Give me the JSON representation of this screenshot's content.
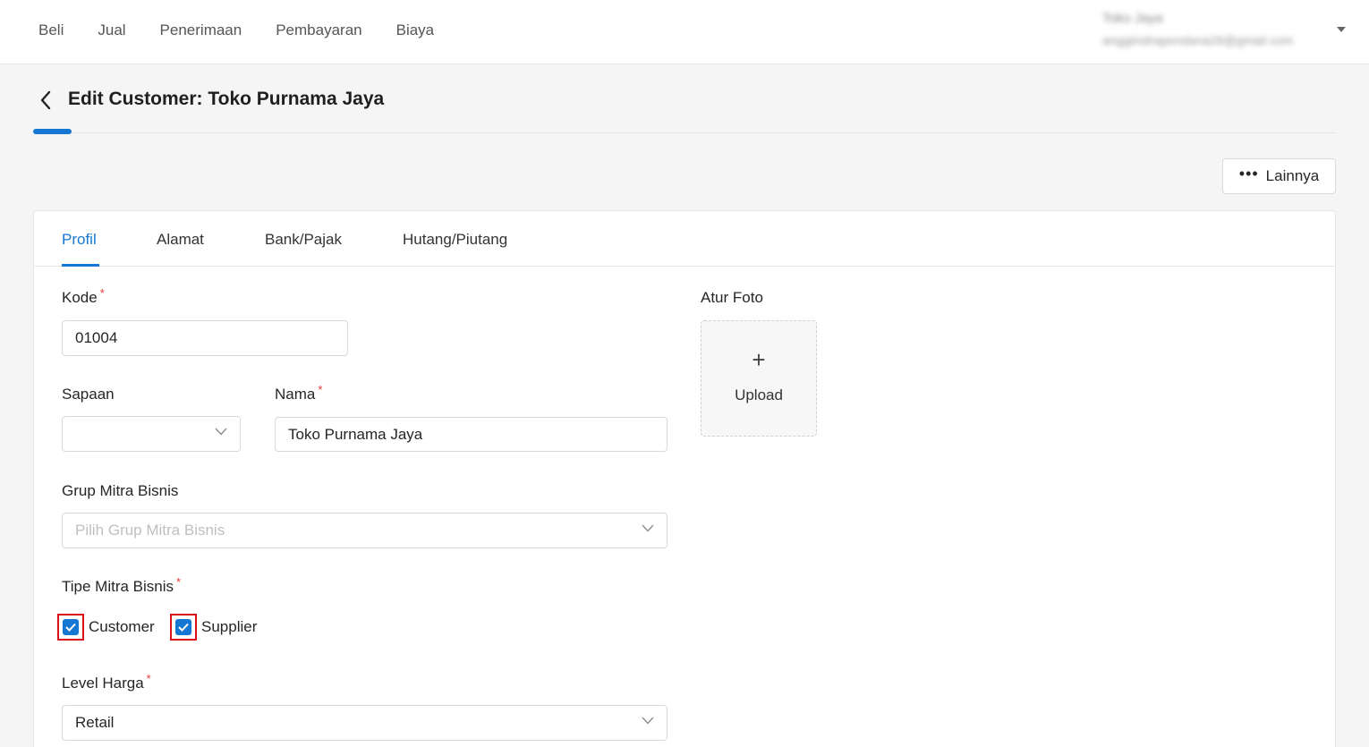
{
  "nav": {
    "items": [
      "Beli",
      "Jual",
      "Penerimaan",
      "Pembayaran",
      "Biaya"
    ],
    "account_name": "Toko Jaya",
    "account_email": "anggiindrapendana28@gmail.com"
  },
  "header": {
    "title": "Edit Customer: Toko Purnama Jaya",
    "more_label": "Lainnya"
  },
  "tabs": [
    "Profil",
    "Alamat",
    "Bank/Pajak",
    "Hutang/Piutang"
  ],
  "form": {
    "kode_label": "Kode",
    "kode_value": "01004",
    "sapaan_label": "Sapaan",
    "sapaan_value": "",
    "nama_label": "Nama",
    "nama_value": "Toko Purnama Jaya",
    "grup_label": "Grup Mitra Bisnis",
    "grup_placeholder": "Pilih Grup Mitra Bisnis",
    "tipe_label": "Tipe Mitra Bisnis",
    "tipe_options": [
      {
        "label": "Customer",
        "checked": true
      },
      {
        "label": "Supplier",
        "checked": true
      }
    ],
    "level_label": "Level Harga",
    "level_value": "Retail",
    "required_mark": "*"
  },
  "photo": {
    "label": "Atur Foto",
    "plus": "+",
    "upload_label": "Upload"
  },
  "colors": {
    "accent": "#1677d2",
    "required": "#e53935",
    "highlight_border": "#d9111b"
  }
}
